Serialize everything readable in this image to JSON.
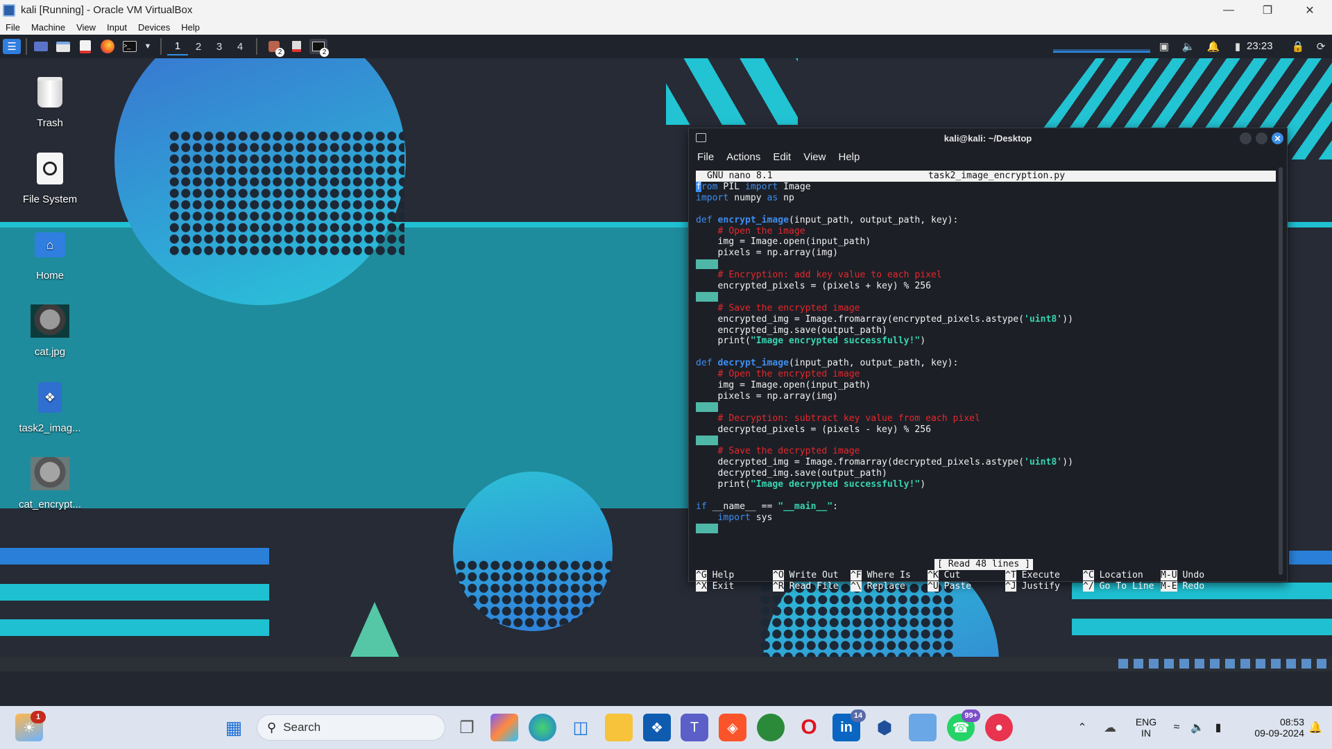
{
  "window": {
    "title": "kali [Running] - Oracle VM VirtualBox"
  },
  "vbox_menu": [
    "File",
    "Machine",
    "View",
    "Input",
    "Devices",
    "Help"
  ],
  "panel": {
    "workspaces": [
      "1",
      "2",
      "3",
      "4"
    ],
    "active_workspace": "1",
    "clock": "23:23",
    "badge_a": "2",
    "badge_b": "2"
  },
  "desktop_icons": [
    {
      "label": "Trash",
      "icon": "trash-icon"
    },
    {
      "label": "File System",
      "icon": "drive-icon"
    },
    {
      "label": "Home",
      "icon": "home-folder-icon"
    },
    {
      "label": "cat.jpg",
      "icon": "image-thumbnail"
    },
    {
      "label": "task2_imag...",
      "icon": "python-file-icon"
    },
    {
      "label": "cat_encrypt...",
      "icon": "image-thumbnail"
    }
  ],
  "terminal": {
    "title": "kali@kali: ~/Desktop",
    "menu": [
      "File",
      "Actions",
      "Edit",
      "View",
      "Help"
    ],
    "nano_version": "GNU nano 8.1",
    "filename": "task2_image_encryption.py",
    "status": "[ Read 48 lines ]",
    "shortcuts": [
      {
        "k1": "^G",
        "l1": "Help",
        "k2": "^X",
        "l2": "Exit"
      },
      {
        "k1": "^O",
        "l1": "Write Out",
        "k2": "^R",
        "l2": "Read File"
      },
      {
        "k1": "^F",
        "l1": "Where Is",
        "k2": "^\\",
        "l2": "Replace"
      },
      {
        "k1": "^K",
        "l1": "Cut",
        "k2": "^U",
        "l2": "Paste"
      },
      {
        "k1": "^T",
        "l1": "Execute",
        "k2": "^J",
        "l2": "Justify"
      },
      {
        "k1": "^C",
        "l1": "Location",
        "k2": "^/",
        "l2": "Go To Line"
      },
      {
        "k1": "M-U",
        "l1": "Undo",
        "k2": "M-E",
        "l2": "Redo"
      }
    ]
  },
  "taskbar": {
    "search_label": "Search",
    "weather_badge": "1",
    "linkedin_badge": "14",
    "whatsapp_badge": "99+",
    "lang": "ENG",
    "region": "IN",
    "time": "08:53",
    "date": "09-09-2024"
  },
  "colors": {
    "accent": "#1fc0d2",
    "terminal_bg": "#1c1f26",
    "keyword": "#3e8ef2",
    "comment": "#e8272b",
    "string": "#38d4b0"
  }
}
